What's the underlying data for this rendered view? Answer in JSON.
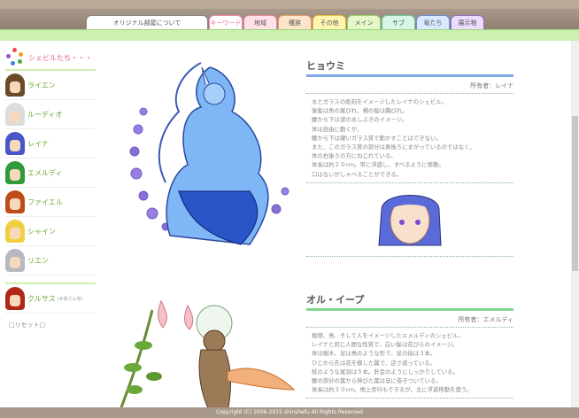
{
  "tabs": [
    {
      "label": "オリジナル部屋について",
      "bg": "#ffffff",
      "border": "#888888",
      "color": "#555555",
      "w": 138
    },
    {
      "label": "キーワード",
      "bg": "#ffffff",
      "border": "#f08ab0",
      "color": "#e86b9a",
      "w": 38
    },
    {
      "label": "地域",
      "bg": "#ffe0e8",
      "border": "#e88aa0",
      "color": "#555555",
      "w": 38
    },
    {
      "label": "種族",
      "bg": "#ffe4cc",
      "border": "#e8a070",
      "color": "#555555",
      "w": 38
    },
    {
      "label": "その他",
      "bg": "#fff4b0",
      "border": "#e8c040",
      "color": "#555555",
      "w": 38
    },
    {
      "label": "メイン",
      "bg": "#e6f8c8",
      "border": "#a0d070",
      "color": "#555555",
      "w": 38
    },
    {
      "label": "サブ",
      "bg": "#d8f6e6",
      "border": "#70c8a0",
      "color": "#555555",
      "w": 38
    },
    {
      "label": "竜たち",
      "bg": "#d8eaff",
      "border": "#7090d0",
      "color": "#555555",
      "w": 38
    },
    {
      "label": "展示物",
      "bg": "#ecdcff",
      "border": "#9070c8",
      "color": "#555555",
      "w": 38
    }
  ],
  "sidebar": {
    "header": "シェビルたち・・・",
    "items": [
      {
        "name": "ライエン",
        "hair": "#6b4a2a"
      },
      {
        "name": "ルーディオ",
        "hair": "#dcdcdc"
      },
      {
        "name": "レイナ",
        "hair": "#4a56c8"
      },
      {
        "name": "エメルディ",
        "hair": "#2f9a3a"
      },
      {
        "name": "ファイエル",
        "hair": "#c04a1a"
      },
      {
        "name": "シャイン",
        "hair": "#f0d040"
      },
      {
        "name": "リエン",
        "hair": "#b8b8c0"
      }
    ],
    "extra": {
      "name": "クルサス",
      "note": "(木体さん宅)",
      "hair": "#b02818"
    },
    "reset": "□リセット□"
  },
  "sections": [
    {
      "title": "ヒョウミ",
      "owner": "所有者：レイナ",
      "lines": [
        "水とガラスの彫刻をイメージしたレイナのシェビル。",
        "後髪は魚の尾びれ、横の髪は胸びれ。",
        "腰から下は波の水しぶきのイメージ。",
        "体は自由に動くが、",
        "腰から下は硬いガラス質で動かすことはできない。",
        "また、このガラス質の部分は真後ろにまがっているのではなく、",
        "体の右後ろの方にねじれている。",
        "体長は約２０cm。常に浮遊し、すべるように移動。",
        "口はないがしゃべることができる。"
      ]
    },
    {
      "title": "オル・イープ",
      "owner": "所有者：エメルディ",
      "lines": [
        "植物、鳥、そして人をイメージしたエメルディのシェビル。",
        "レイナと同じ人間な性質で、白い髪は花びらのイメージ。",
        "体は樹木、足は鳥のような形で、足の指は３本。",
        "ひじから先は花を模した翼で、逆さ道っている。",
        "枝のような尾羽は５本。針金のようにしっかりしている。",
        "腰の部分の葉から伸びた葉は足に巻きついている。",
        "体長は約３０cm。地上歩行もできるが、主に浮遊移動を使う。"
      ]
    }
  ],
  "footer": "Copyright (C) 2006-2015 shinshefu All Rights Reserved"
}
